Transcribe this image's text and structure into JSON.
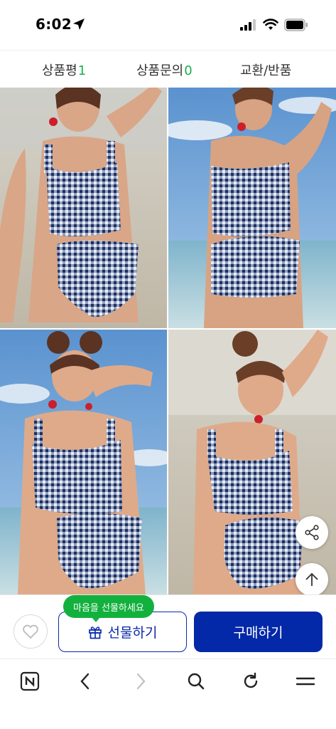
{
  "status_bar": {
    "time": "6:02",
    "location_icon": "location-arrow-icon",
    "signal_icon": "cellular-signal-icon",
    "wifi_icon": "wifi-icon",
    "battery_icon": "battery-icon"
  },
  "tabs": [
    {
      "label": "상품평",
      "count": "1"
    },
    {
      "label": "상품문의",
      "count": "0"
    },
    {
      "label": "교환/반품",
      "count": ""
    }
  ],
  "colors": {
    "accent_green": "#16b14a",
    "primary_blue": "#0328a8",
    "tooltip_green": "#12b13e"
  },
  "photos": [
    {
      "icon": "product-photo-front"
    },
    {
      "icon": "product-photo-back"
    },
    {
      "icon": "product-photo-front-closeup"
    },
    {
      "icon": "product-photo-pose"
    }
  ],
  "floating": {
    "share_icon": "share-icon",
    "top_icon": "arrow-up-icon"
  },
  "purchase_bar": {
    "tooltip": "마음을 선물하세요",
    "gift_label": "선물하기",
    "buy_label": "구매하기",
    "heart_icon": "heart-icon",
    "gift_icon": "gift-icon"
  },
  "browser_nav": {
    "items": [
      "naver-n-icon",
      "back-icon",
      "forward-icon",
      "search-icon",
      "refresh-icon",
      "menu-icon"
    ]
  }
}
